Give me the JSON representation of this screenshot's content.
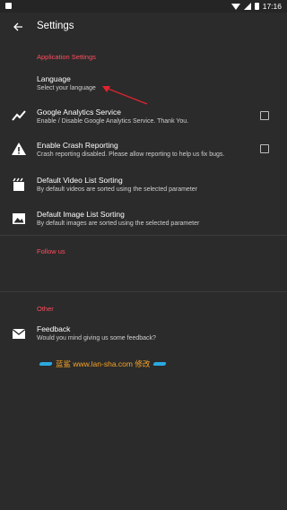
{
  "status_bar": {
    "time": "17:16"
  },
  "toolbar": {
    "title": "Settings"
  },
  "sections": {
    "application": {
      "label": "Application Settings"
    },
    "follow": {
      "label": "Follow us"
    },
    "other": {
      "label": "Other"
    }
  },
  "items": {
    "language": {
      "title": "Language",
      "subtitle": "Select your language"
    },
    "analytics": {
      "title": "Google Analytics Service",
      "subtitle": "Enable / Disable Google Analytics Service. Thank You.",
      "checked": false
    },
    "crash": {
      "title": "Enable Crash Reporting",
      "subtitle": "Crash reporting disabled. Please allow reporting to help us fix bugs.",
      "checked": false
    },
    "video_sort": {
      "title": "Default Video List Sorting",
      "subtitle": "By default videos are sorted using the selected parameter"
    },
    "image_sort": {
      "title": "Default Image List Sorting",
      "subtitle": "By default images are sorted using the selected parameter"
    },
    "feedback": {
      "title": "Feedback",
      "subtitle": "Would you mind giving us some feedback?"
    }
  },
  "watermark": {
    "text": "蓝鲨 www.lan-sha.com 修改"
  },
  "colors": {
    "accent": "#ff4d5e",
    "background": "#2b2b2b",
    "arrow": "#e0242f",
    "watermark": "#f7a323"
  }
}
